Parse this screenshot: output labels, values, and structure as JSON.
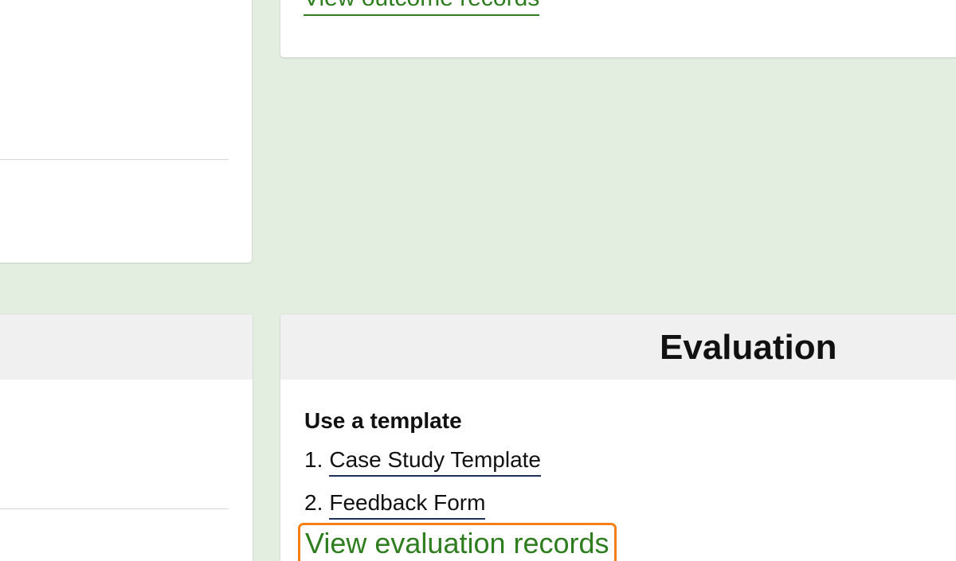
{
  "top_card": {
    "link_label": "View outcome records"
  },
  "evaluation": {
    "title": "Evaluation",
    "section_label": "Use a template",
    "templates": [
      {
        "number": "1.",
        "label": "Case Study Template"
      },
      {
        "number": "2.",
        "label": "Feedback Form"
      }
    ],
    "view_link_label": "View evaluation records"
  },
  "colors": {
    "page_background": "#e3eee1",
    "link_green": "#2e7d1e",
    "highlight_orange": "#f47f16",
    "header_gray": "#f0f0f0"
  }
}
